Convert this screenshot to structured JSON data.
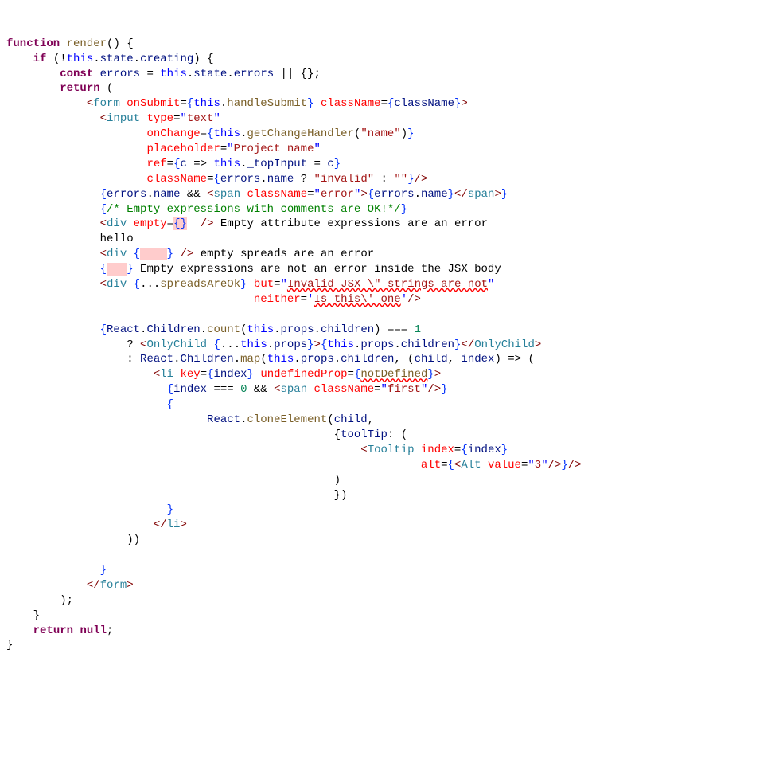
{
  "code": {
    "l01": {
      "kw1": "function",
      "fn": "render",
      "p": "() {"
    },
    "l02": {
      "kw": "if",
      "p1": " (!",
      "this": "this",
      "p2": ".",
      "prop1": "state",
      "p3": ".",
      "prop2": "creating",
      "p4": ") {"
    },
    "l03": {
      "kw": "const",
      "var": "errors",
      "op": " = ",
      "this": "this",
      "d1": ".",
      "p1": "state",
      "d2": ".",
      "p2": "errors",
      "rest": " || {};"
    },
    "l04": {
      "kw": "return",
      "p": " ("
    },
    "l05": {
      "lt": "<",
      "tag": "form",
      "sp": " ",
      "a1": "onSubmit",
      "eq1": "=",
      "ob1": "{",
      "this1": "this",
      "d1": ".",
      "m1": "handleSubmit",
      "cb1": "}",
      "sp2": " ",
      "a2": "className",
      "eq2": "=",
      "ob2": "{",
      "v2": "className",
      "cb2": "}",
      "gt": ">"
    },
    "l06": {
      "lt": "<",
      "tag": "input",
      "sp": " ",
      "a": "type",
      "eq": "=",
      "q1": "\"",
      "s": "text",
      "q2": "\""
    },
    "l07": {
      "a": "onChange",
      "eq": "=",
      "ob": "{",
      "this": "this",
      "d": ".",
      "m": "getChangeHandler",
      "p1": "(",
      "q1": "\"",
      "s": "name",
      "q2": "\"",
      ") ": ")",
      "cb": "}"
    },
    "l08": {
      "a": "placeholder",
      "eq": "=",
      "q1": "\"",
      "s": "Project name",
      "q2": "\""
    },
    "l09": {
      "a": "ref",
      "eq": "=",
      "ob": "{",
      "arg": "c",
      "arrow": " => ",
      "this": "this",
      "d": ".",
      "prop": "_topInput",
      "asg": " = ",
      "c2": "c",
      "cb": "}"
    },
    "l10": {
      "a": "className",
      "eq": "=",
      "ob": "{",
      "v": "errors",
      "d": ".",
      "p": "name",
      "q": " ? ",
      "q1": "\"",
      "s1": "invalid",
      "q2": "\"",
      "col": " : ",
      "q3": "\"",
      "q4": "\"",
      "cb": "}",
      "end": "/>"
    },
    "l11": {
      "ob": "{",
      "v": "errors",
      "d": ".",
      "p": "name",
      "and": " && ",
      "lt": "<",
      "tag": "span",
      "sp": " ",
      "a": "className",
      "eq": "=",
      "q1": "\"",
      "s": "error",
      "q2": "\"",
      "gt": ">",
      "ob2": "{",
      "v2": "errors",
      "d2": ".",
      "p2": "name",
      "cb2": "}",
      "lt2": "</",
      "tag2": "span",
      "gt2": ">",
      "cb": "}"
    },
    "l12": {
      "ob": "{",
      "c": "/* Empty expressions with comments are OK!*/",
      "cb": "}"
    },
    "l13": {
      "lt": "<",
      "tag": "div",
      "sp": " ",
      "a": "empty",
      "eq": "=",
      "ob": "{",
      "cb": "}",
      "sp2": "  ",
      "end": "/>",
      "txt": " Empty attribute expressions are an error"
    },
    "l14": {
      "txt": "hello"
    },
    "l15": {
      "lt": "<",
      "tag": "div",
      "sp": " ",
      "ob": "{",
      "sp2": "    ",
      "cb": "}",
      "sp3": " ",
      "end": "/>",
      "txt": " empty spreads are an error"
    },
    "l16": {
      "ob": "{",
      "sp": "   ",
      "cb": "}",
      "txt": " Empty expressions are not an error inside the JSX body"
    },
    "l17": {
      "lt": "<",
      "tag": "div",
      "sp": " ",
      "ob": "{",
      "spread": "...",
      "v": "spreadsAreOk",
      "cb": "}",
      "sp2": " ",
      "a": "but",
      "eq": "=",
      "q1": "\"",
      "s": "Invalid JSX \\\" strings are not",
      "q2": "\""
    },
    "l18": {
      "a": "neither",
      "eq": "=",
      "q1": "'",
      "s": "Is this\\' one",
      "q2": "'",
      "end": "/>"
    },
    "l19": "",
    "l20": {
      "ob": "{",
      "v": "React",
      "d": ".",
      "p": "Children",
      "d2": ".",
      "m": "count",
      "po": "(",
      "this": "this",
      "d3": ".",
      "p2": "props",
      "d4": ".",
      "p3": "children",
      "pc": ")",
      "eq": " === ",
      "n": "1"
    },
    "l21": {
      "q": "? ",
      "lt": "<",
      "tag": "OnlyChild",
      "sp": " ",
      "ob": "{",
      "spread": "...",
      "this": "this",
      "d": ".",
      "p": "props",
      "cb": "}",
      "gt": ">",
      "ob2": "{",
      "this2": "this",
      "d2": ".",
      "p2": "props",
      "d3": ".",
      "p3": "children",
      "cb2": "}",
      "lt2": "</",
      "tag2": "OnlyChild",
      "gt2": ">"
    },
    "l22": {
      "c": ": ",
      "v": "React",
      "d": ".",
      "p": "Children",
      "d2": ".",
      "m": "map",
      "po": "(",
      "this": "this",
      "d3": ".",
      "p2": "props",
      "d4": ".",
      "p3": "children",
      "cm": ", (",
      "a1": "child",
      "cm2": ", ",
      "a2": "index",
      "pc": ") => ("
    },
    "l23": {
      "lt": "<",
      "tag": "li",
      "sp": " ",
      "a1": "key",
      "eq1": "=",
      "ob1": "{",
      "v1": "index",
      "cb1": "}",
      "sp2": " ",
      "a2": "undefinedProp",
      "eq2": "=",
      "ob2": "{",
      "v2": "notDefined",
      "cb2": "}",
      "gt": ">"
    },
    "l24": {
      "ob": "{",
      "v": "index",
      "eq": " === ",
      "n": "0",
      "and": " && ",
      "lt": "<",
      "tag": "span",
      "sp": " ",
      "a": "className",
      "eq2": "=",
      "q1": "\"",
      "s": "first",
      "q2": "\"",
      "end": "/>",
      "cb": "}"
    },
    "l25": {
      "ob": "{"
    },
    "l26": {
      "v": "React",
      "d": ".",
      "m": "cloneElement",
      "po": "(",
      "a": "child",
      "cm": ","
    },
    "l27": {
      "ob": "{",
      "p": "toolTip",
      "c": ": ("
    },
    "l28": {
      "lt": "<",
      "tag": "Tooltip",
      "sp": " ",
      "a": "index",
      "eq": "=",
      "ob": "{",
      "v": "index",
      "cb": "}"
    },
    "l29": {
      "a": "alt",
      "eq": "=",
      "ob": "{",
      "lt": "<",
      "tag": "Alt",
      "sp": " ",
      "a2": "value",
      "eq2": "=",
      "q1": "\"",
      "s": "3",
      "q2": "\"",
      "end": "/>",
      "cb": "}",
      "end2": "/>"
    },
    "l30": {
      "p": ")"
    },
    "l31": {
      "p": "})"
    },
    "l32": {
      "cb": "}"
    },
    "l33": {
      "lt": "</",
      "tag": "li",
      "gt": ">"
    },
    "l34": {
      "p": "))"
    },
    "l35": "",
    "l36": {
      "cb": "}"
    },
    "l37": {
      "lt": "</",
      "tag": "form",
      "gt": ">"
    },
    "l38": {
      "p": ");"
    },
    "l39": {
      "p": "}"
    },
    "l40": {
      "kw": "return",
      "sp": " ",
      "null": "null",
      "sc": ";"
    },
    "l41": {
      "p": "}"
    }
  }
}
